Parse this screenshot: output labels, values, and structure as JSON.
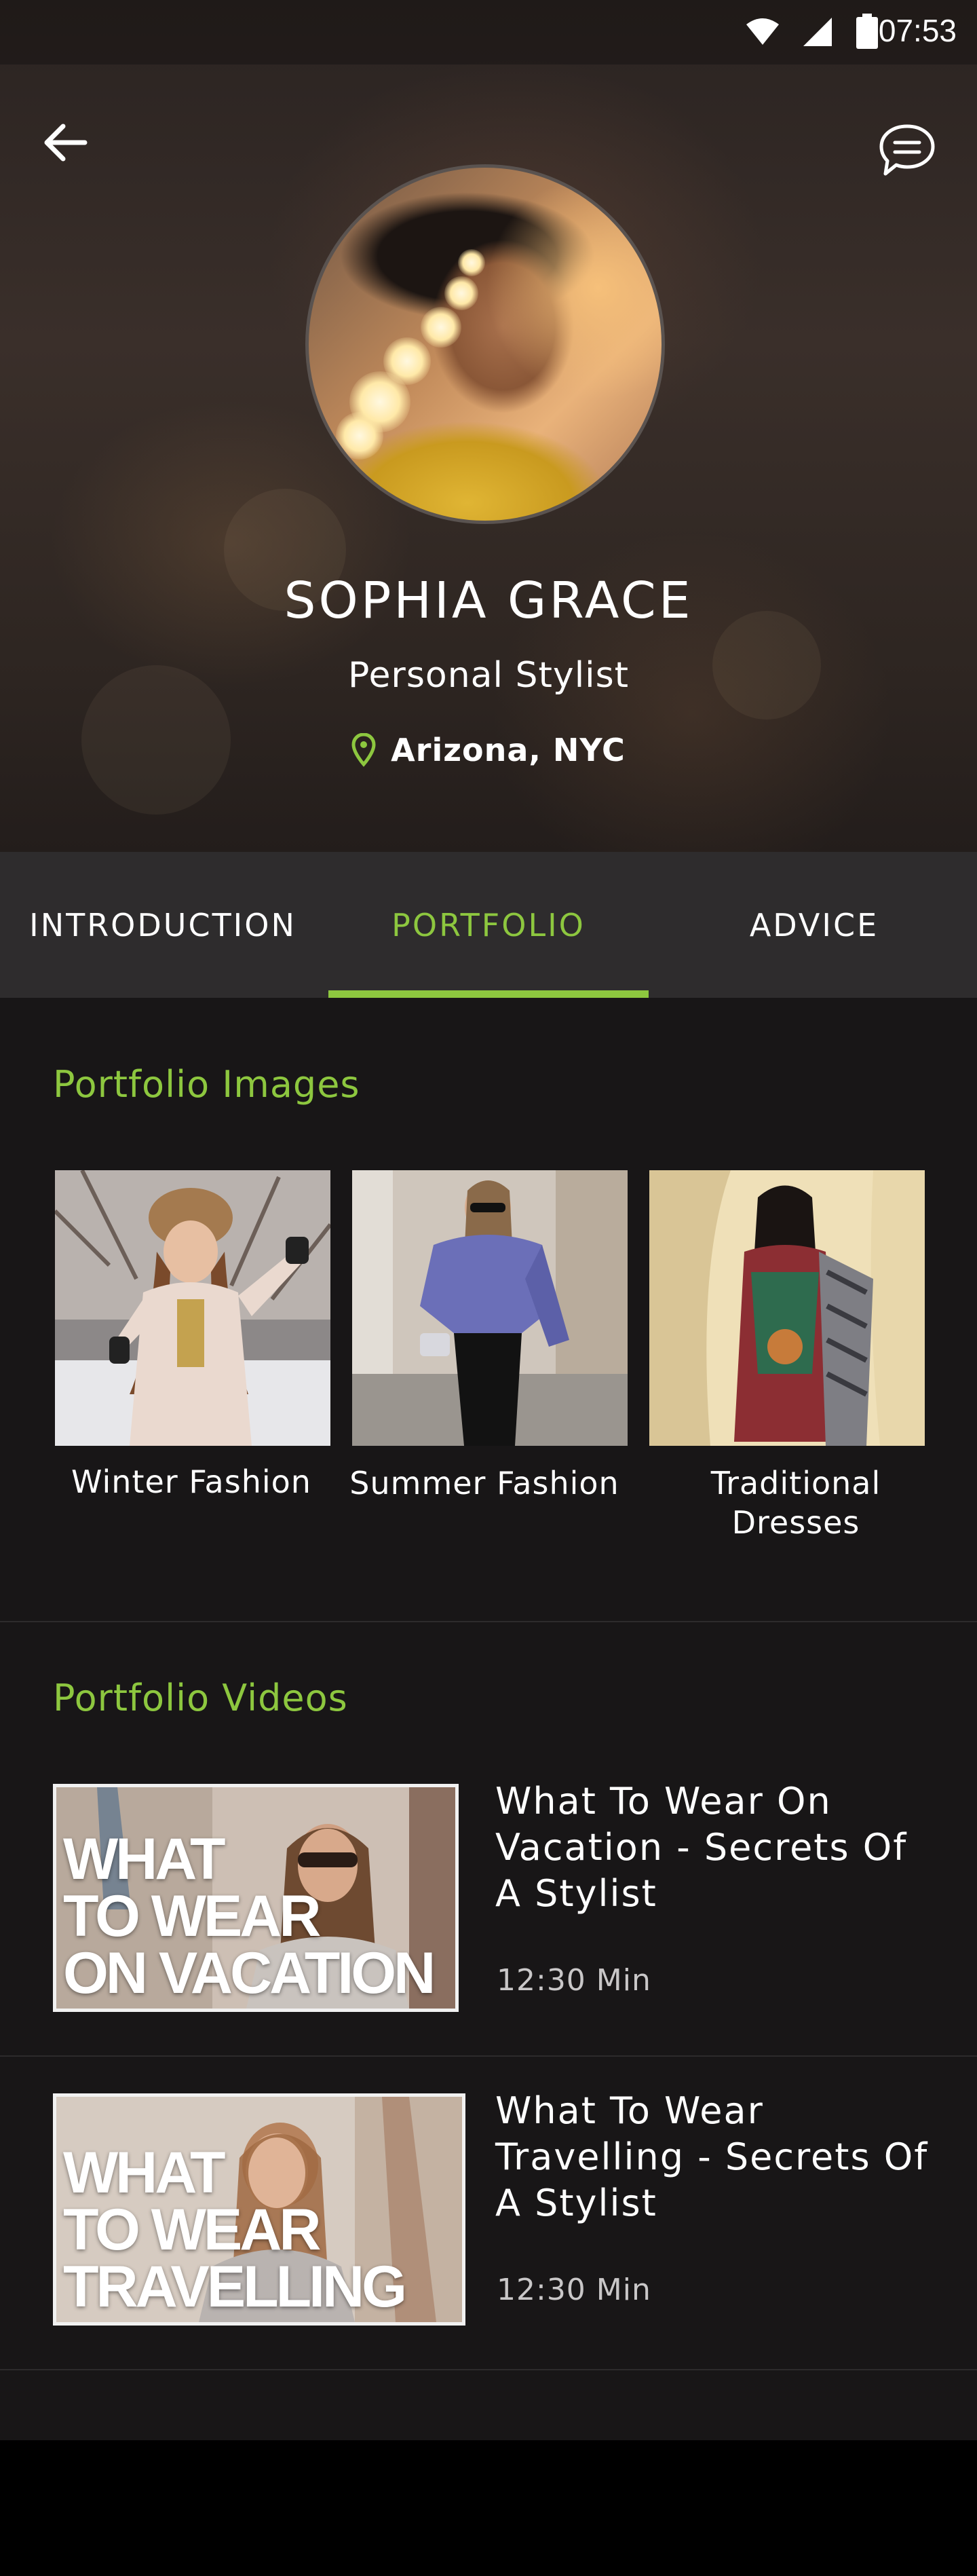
{
  "status_bar": {
    "time": "07:53"
  },
  "header": {
    "back_icon": "arrow-left-icon",
    "chat_icon": "chat-bubble-icon"
  },
  "profile": {
    "name": "SOPHIA GRACE",
    "role": "Personal Stylist",
    "location": "Arizona, NYC",
    "location_icon": "location-pin-icon"
  },
  "tabs": [
    {
      "label": "INTRODUCTION",
      "active": false
    },
    {
      "label": "PORTFOLIO",
      "active": true
    },
    {
      "label": "ADVICE",
      "active": false
    }
  ],
  "portfolio_images": {
    "title": "Portfolio Images",
    "items": [
      {
        "caption": "Winter Fashion"
      },
      {
        "caption": "Summer Fashion"
      },
      {
        "caption": "Traditional Dresses"
      }
    ]
  },
  "portfolio_videos": {
    "title": "Portfolio Videos",
    "items": [
      {
        "thumb_lines": [
          "WHAT",
          "TO WEAR",
          "ON VACATION"
        ],
        "title": "What To Wear On Vacation - Secrets Of A Stylist",
        "duration": "12:30 Min"
      },
      {
        "thumb_lines": [
          "WHAT",
          "TO WEAR",
          "TRAVELLING"
        ],
        "title": "What To Wear Travelling - Secrets Of A Stylist",
        "duration": "12:30 Min"
      }
    ]
  },
  "colors": {
    "accent": "#8dc73f",
    "tab_bar": "#2e2c2d",
    "content_bg": "#181617"
  }
}
